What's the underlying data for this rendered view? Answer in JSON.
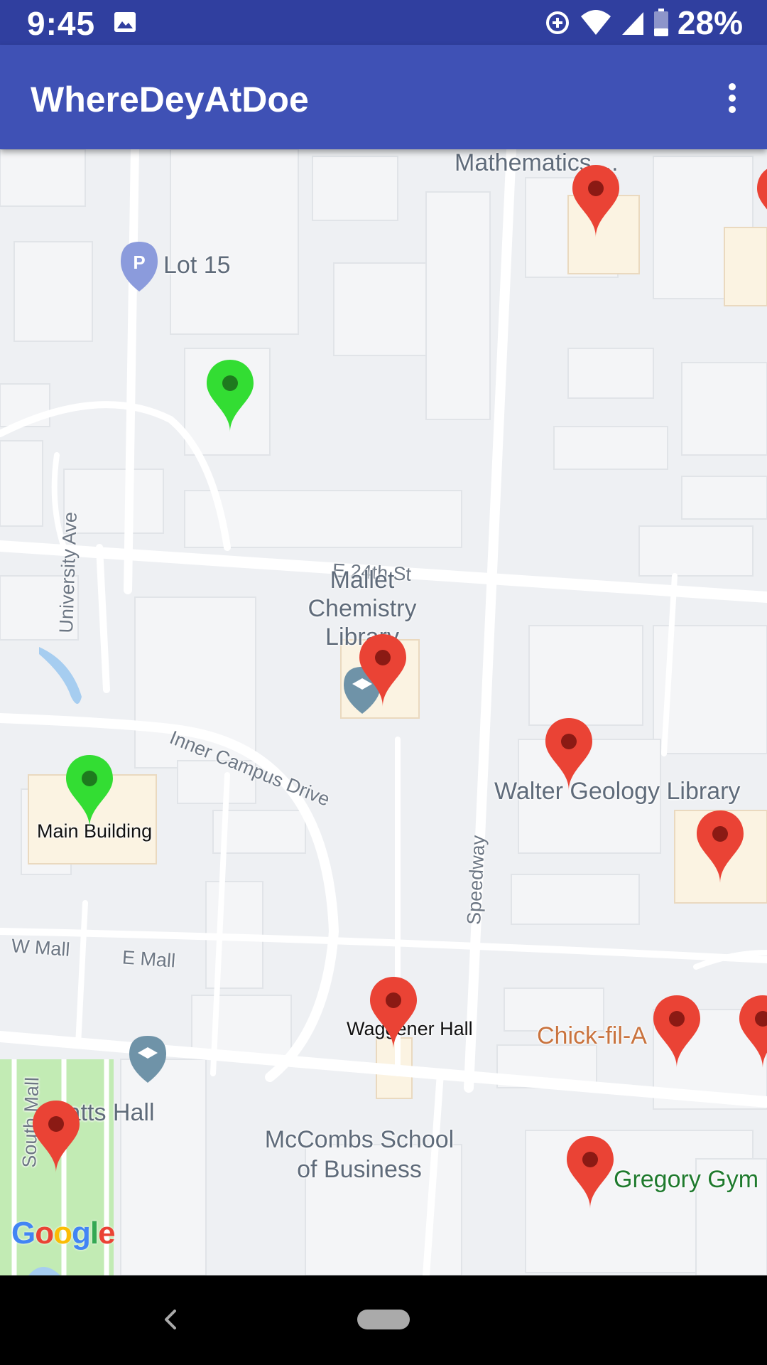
{
  "status_bar": {
    "time": "9:45",
    "battery": "28%",
    "icons": [
      "image-icon",
      "data-saver-icon",
      "wifi-icon",
      "cell-signal-icon",
      "battery-icon"
    ]
  },
  "app_bar": {
    "title": "WhereDeyAtDoe",
    "menu_icon": "more-vert-icon"
  },
  "map": {
    "labels": {
      "mathematics": "Mathematics ...",
      "lot15": "Lot 15",
      "e24th": "E 24th St",
      "mallet_line1": "Mallet",
      "mallet_line2": "Chemistry",
      "mallet_line3": "Library",
      "university_ave": "University Ave",
      "inner_campus": "Inner Campus Drive",
      "walter": "Walter Geology Library",
      "main_building": "Main Building",
      "speedway": "Speedway",
      "w_mall": "W Mall",
      "e_mall": "E Mall",
      "waggener": "Waggener Hall",
      "chickfila": "Chick-fil-A",
      "batts": "Batts Hall",
      "south_mall": "South Mall",
      "mccombs_line1": "McCombs School",
      "mccombs_line2": "of Business",
      "gregory": "Gregory Gym"
    },
    "google_letters": [
      "G",
      "o",
      "o",
      "g",
      "l",
      "e"
    ],
    "pin_colors": {
      "red": "#EA4335",
      "green": "#33DD33",
      "dot": "#8B1A14",
      "green_dot": "#1E7A1E"
    }
  },
  "nav_bar": {
    "back_icon": "back-icon",
    "home_icon": "home-pill-icon"
  }
}
